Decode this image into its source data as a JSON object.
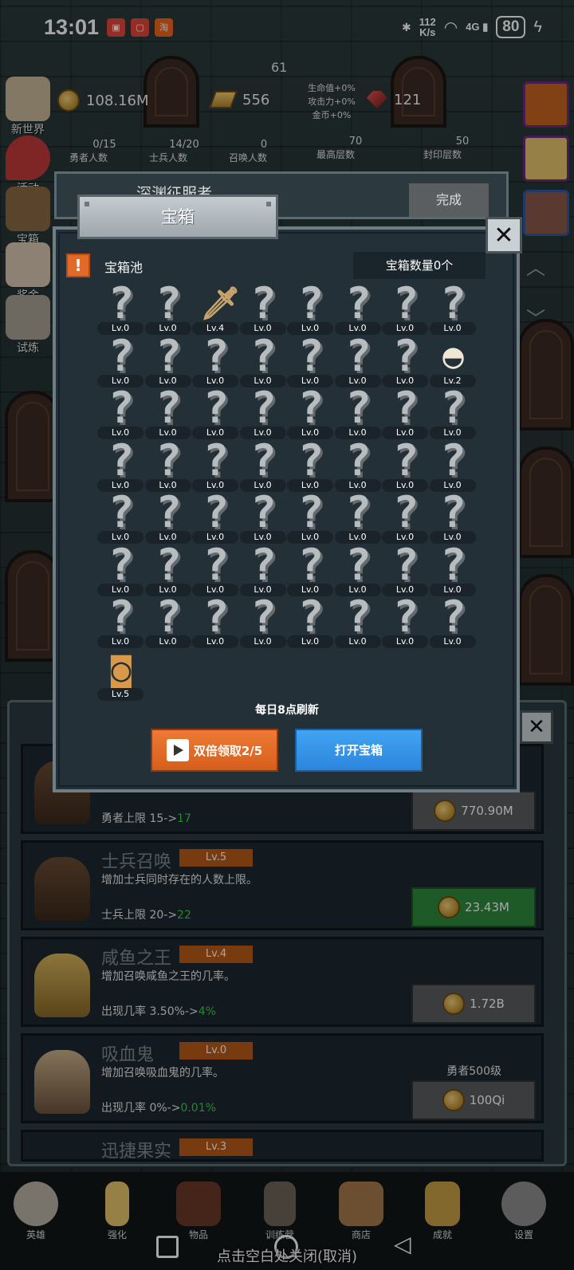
{
  "status_bar": {
    "time": "13:01",
    "net_speed_value": "112",
    "net_speed_unit": "K/s",
    "signal": "4G",
    "battery": "80"
  },
  "header": {
    "floor_number": "61",
    "coins": "108.16M",
    "gold_bars": "556",
    "gems": "121",
    "buffs": [
      "生命值+0%",
      "攻击力+0%",
      "金币+0%"
    ],
    "counts": [
      {
        "value": "0/15",
        "label": "勇者人数"
      },
      {
        "value": "14/20",
        "label": "士兵人数"
      },
      {
        "value": "0",
        "label": "召唤人数"
      },
      {
        "value": "70",
        "label": "最高层数"
      },
      {
        "value": "50",
        "label": "封印层数"
      }
    ]
  },
  "side_menu": [
    {
      "label": "新世界",
      "icon": "map-icon"
    },
    {
      "label": "活动",
      "icon": "heart-icon"
    },
    {
      "label": "宝箱",
      "icon": "chest-icon"
    },
    {
      "label": "奖金",
      "icon": "envelope-icon"
    },
    {
      "label": "试炼",
      "icon": "wing-icon"
    }
  ],
  "behind_card": {
    "title": "深渊征服者",
    "button": "完成"
  },
  "dialog": {
    "title": "宝箱",
    "pool_label": "宝箱池",
    "pool_count": "宝箱数量0个",
    "refresh_note": "每日8点刷新",
    "double_button": "双倍领取2/5",
    "open_button": "打开宝箱",
    "close_symbol": "✕",
    "slots": [
      "Lv.0",
      "Lv.0",
      "Lv.4",
      "Lv.0",
      "Lv.0",
      "Lv.0",
      "Lv.0",
      "Lv.0",
      "Lv.0",
      "Lv.0",
      "Lv.0",
      "Lv.0",
      "Lv.0",
      "Lv.0",
      "Lv.0",
      "Lv.2",
      "Lv.0",
      "Lv.0",
      "Lv.0",
      "Lv.0",
      "Lv.0",
      "Lv.0",
      "Lv.0",
      "Lv.0",
      "Lv.0",
      "Lv.0",
      "Lv.0",
      "Lv.0",
      "Lv.0",
      "Lv.0",
      "Lv.0",
      "Lv.0",
      "Lv.0",
      "Lv.0",
      "Lv.0",
      "Lv.0",
      "Lv.0",
      "Lv.0",
      "Lv.0",
      "Lv.0",
      "Lv.0",
      "Lv.0",
      "Lv.0",
      "Lv.0",
      "Lv.0",
      "Lv.0",
      "Lv.0",
      "Lv.0",
      "Lv.0",
      "Lv.0",
      "Lv.0",
      "Lv.0",
      "Lv.0",
      "Lv.0",
      "Lv.0",
      "Lv.0",
      "Lv.5"
    ],
    "slot_items": {
      "2": "sword-icon",
      "15": "bowl-icon",
      "56": "beer-mug-icon"
    }
  },
  "upgrades": [
    {
      "title": "",
      "level": "",
      "desc": "",
      "effect_prefix": "勇者上限 15->",
      "effect_to": "17",
      "price": "770.90M",
      "affordable": false,
      "requirement": ""
    },
    {
      "title": "士兵召唤",
      "level": "Lv.5",
      "desc": "增加士兵同时存在的人数上限。",
      "effect_prefix": "士兵上限 20->",
      "effect_to": "22",
      "price": "23.43M",
      "affordable": true,
      "requirement": ""
    },
    {
      "title": "咸鱼之王",
      "level": "Lv.4",
      "desc": "增加召唤咸鱼之王的几率。",
      "effect_prefix": "出现几率 3.50%->",
      "effect_to": "4%",
      "price": "1.72B",
      "affordable": false,
      "requirement": ""
    },
    {
      "title": "吸血鬼",
      "level": "Lv.0",
      "desc": "增加召唤吸血鬼的几率。",
      "effect_prefix": "出现几率 0%->",
      "effect_to": "0.01%",
      "price": "100Qi",
      "affordable": false,
      "requirement": "勇者500级"
    },
    {
      "title": "迅捷果实",
      "level": "Lv.3",
      "desc": "",
      "effect_prefix": "",
      "effect_to": "",
      "price": "",
      "affordable": false,
      "requirement": ""
    }
  ],
  "bottom_nav": [
    {
      "label": "英雄",
      "icon": "skull-icon"
    },
    {
      "label": "强化",
      "icon": "candle-icon"
    },
    {
      "label": "物品",
      "icon": "book-icon"
    },
    {
      "label": "训练营",
      "icon": "lantern-icon"
    },
    {
      "label": "商店",
      "icon": "beer-mug-icon"
    },
    {
      "label": "成就",
      "icon": "key-icon"
    },
    {
      "label": "设置",
      "icon": "gear-icon"
    }
  ],
  "close_hint": "点击空白处关闭(取消)",
  "colors": {
    "orange_button": "#e1692a",
    "blue_button": "#3a9ae8",
    "green_price": "#2e8a3e",
    "level_badge": "#b85a18",
    "effect_green": "#3fcc4a"
  }
}
